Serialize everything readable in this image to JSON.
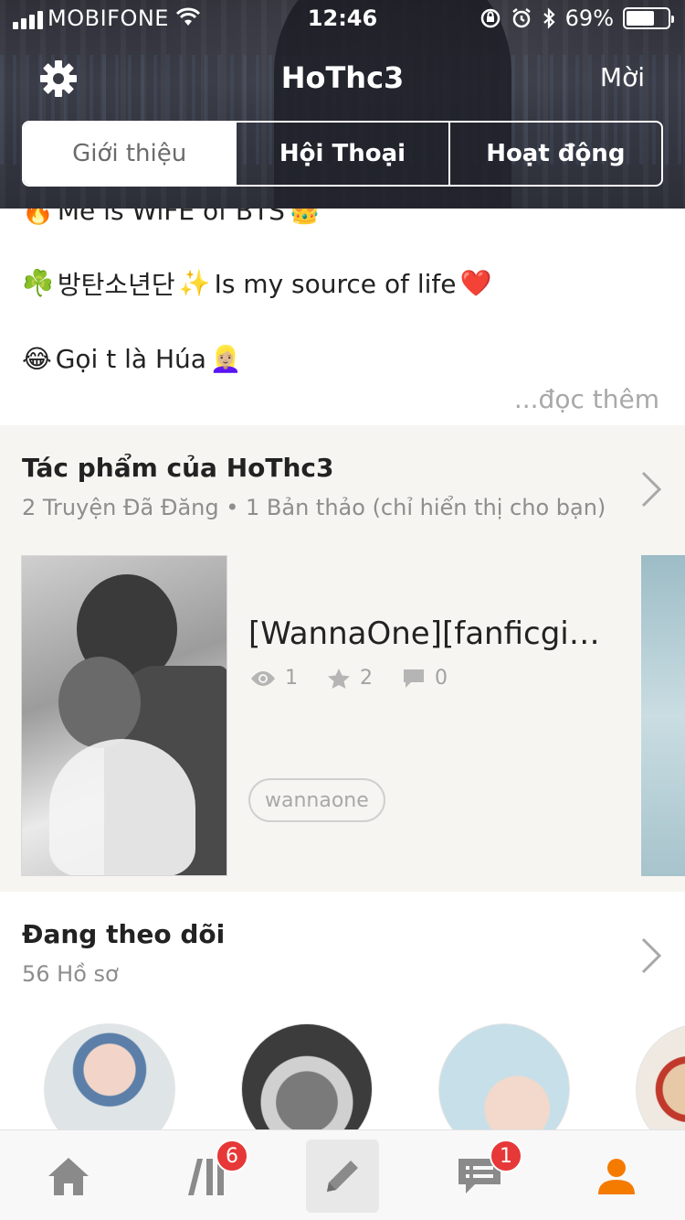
{
  "status_bar": {
    "carrier": "MOBIFONE",
    "time": "12:46",
    "battery_percent": "69%",
    "battery_level": 0.69,
    "icons": [
      "signal-icon",
      "wifi-icon",
      "rotation-lock-icon",
      "alarm-icon",
      "bluetooth-icon",
      "battery-icon"
    ]
  },
  "header": {
    "title": "HoThc3",
    "invite_label": "Mời",
    "settings_icon": "gear-icon"
  },
  "tabs": [
    {
      "label": "Giới thiệu",
      "active": true
    },
    {
      "label": "Hội Thoại",
      "active": false
    },
    {
      "label": "Hoạt động",
      "active": false
    }
  ],
  "about": {
    "partial_line": "Me is WiFE of BTS",
    "partial_line_emoji_left": "🔥",
    "partial_line_emoji_right": "👑",
    "line2_emoji_left": "☘️",
    "line2_text_a": "방탄소년단",
    "line2_emoji_mid": "✨",
    "line2_text_b": "Is my source of life",
    "line2_emoji_right": "❤️",
    "line3_emoji_left": "😂",
    "line3_text": "Gọi t là Húa",
    "line3_emoji_right": "👱🏼‍♀️",
    "read_more": "...đọc thêm"
  },
  "works": {
    "title": "Tác phẩm của HoThc3",
    "subtitle": "2 Truyện Đã Đăng • 1 Bản thảo (chỉ hiển thị cho bạn)",
    "story": {
      "title": "[WannaOne][fanficgi…",
      "views": "1",
      "votes": "2",
      "comments": "0",
      "tag": "wannaone"
    }
  },
  "following": {
    "title": "Đang theo dõi",
    "subtitle": "56 Hồ sơ"
  },
  "tabbar": {
    "library_badge": "6",
    "messages_badge": "1",
    "accent_color": "#f57b00"
  },
  "colors": {
    "accent": "#f57b00",
    "badge": "#e63838",
    "section_bg": "#f6f5f1"
  }
}
